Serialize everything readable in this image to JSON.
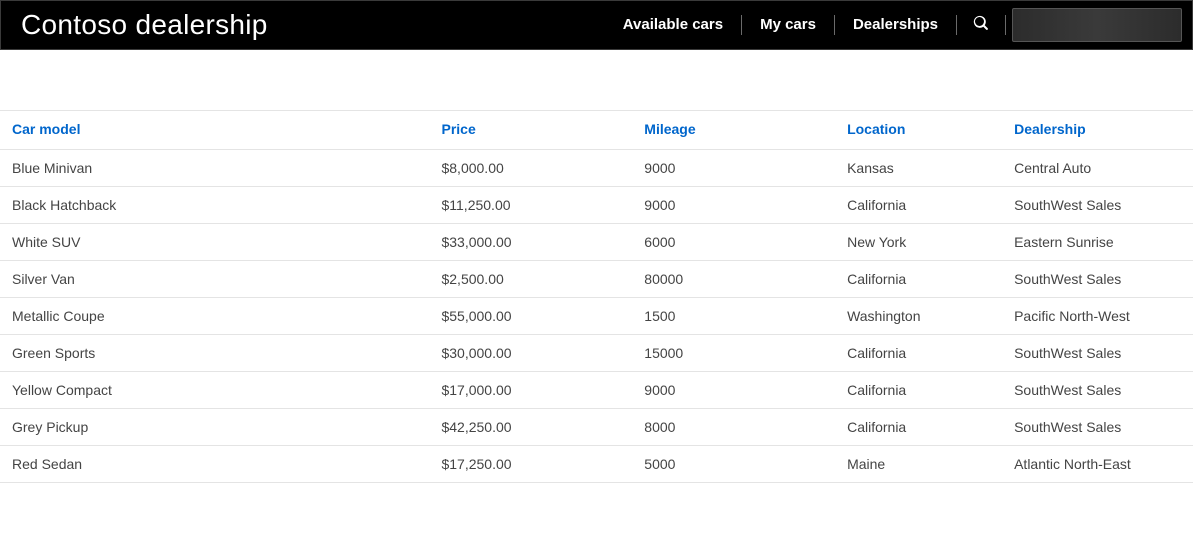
{
  "header": {
    "brand": "Contoso dealership",
    "nav": [
      {
        "label": "Available cars"
      },
      {
        "label": "My cars"
      },
      {
        "label": "Dealerships"
      }
    ]
  },
  "table": {
    "columns": {
      "model": "Car model",
      "price": "Price",
      "mileage": "Mileage",
      "location": "Location",
      "dealership": "Dealership"
    },
    "rows": [
      {
        "model": "Blue Minivan",
        "price": "$8,000.00",
        "mileage": "9000",
        "location": "Kansas",
        "dealership": "Central Auto"
      },
      {
        "model": "Black Hatchback",
        "price": "$11,250.00",
        "mileage": "9000",
        "location": "California",
        "dealership": "SouthWest Sales"
      },
      {
        "model": "White SUV",
        "price": "$33,000.00",
        "mileage": "6000",
        "location": "New York",
        "dealership": "Eastern Sunrise"
      },
      {
        "model": "Silver Van",
        "price": "$2,500.00",
        "mileage": "80000",
        "location": "California",
        "dealership": "SouthWest Sales"
      },
      {
        "model": "Metallic Coupe",
        "price": "$55,000.00",
        "mileage": "1500",
        "location": "Washington",
        "dealership": "Pacific North-West"
      },
      {
        "model": "Green Sports",
        "price": "$30,000.00",
        "mileage": "15000",
        "location": "California",
        "dealership": "SouthWest Sales"
      },
      {
        "model": "Yellow Compact",
        "price": "$17,000.00",
        "mileage": "9000",
        "location": "California",
        "dealership": "SouthWest Sales"
      },
      {
        "model": "Grey Pickup",
        "price": "$42,250.00",
        "mileage": "8000",
        "location": "California",
        "dealership": "SouthWest Sales"
      },
      {
        "model": "Red Sedan",
        "price": "$17,250.00",
        "mileage": "5000",
        "location": "Maine",
        "dealership": "Atlantic North-East"
      }
    ]
  }
}
